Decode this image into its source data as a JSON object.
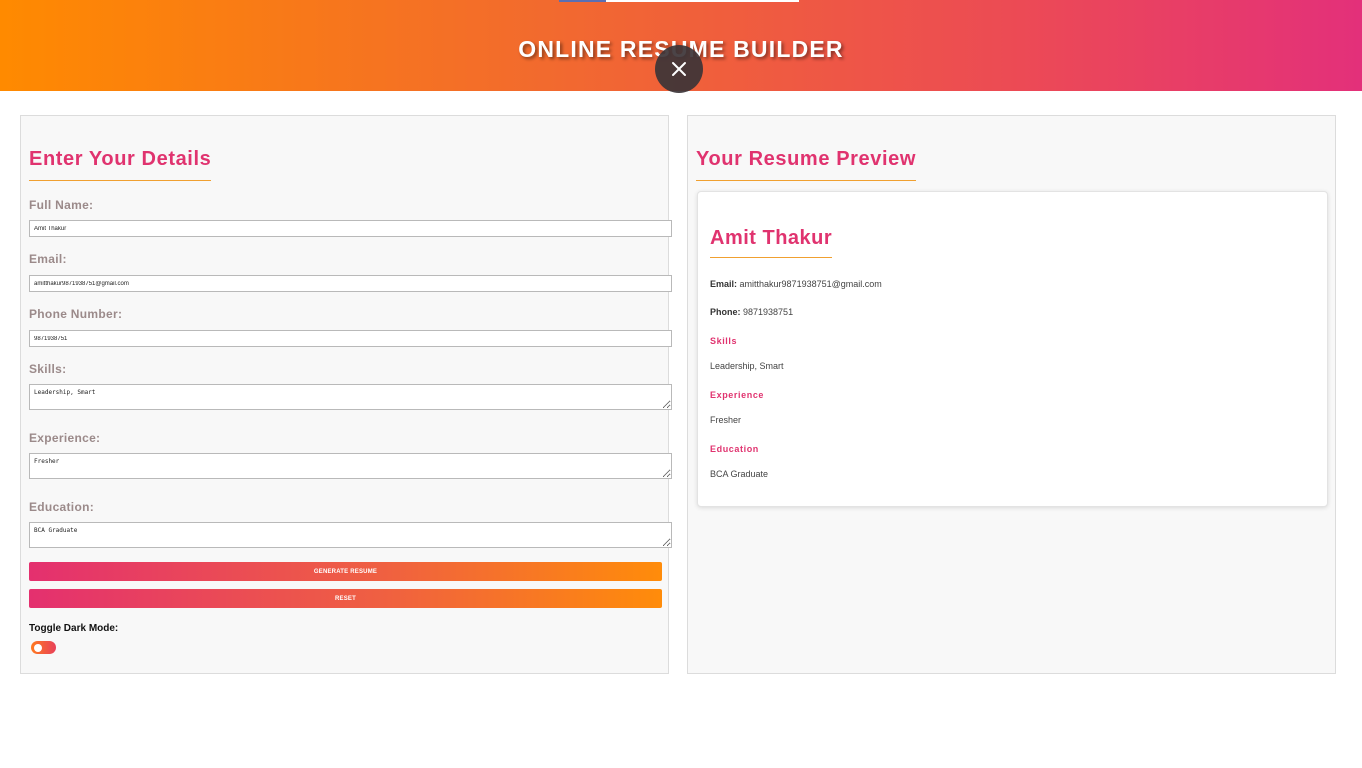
{
  "header": {
    "title": "ONLINE RESUME BUILDER"
  },
  "overlay": {
    "close_icon": "close-icon"
  },
  "form": {
    "title": "Enter Your Details",
    "full_name": {
      "label": "Full Name:",
      "value": "Amit Thakur"
    },
    "email": {
      "label": "Email:",
      "value": "amitthakur9871938751@gmail.com"
    },
    "phone": {
      "label": "Phone Number:",
      "value": "9871938751"
    },
    "skills": {
      "label": "Skills:",
      "value": "Leadership, Smart"
    },
    "experience": {
      "label": "Experience:",
      "value": "Fresher"
    },
    "education": {
      "label": "Education:",
      "value": "BCA Graduate"
    },
    "generate_label": "GENERATE RESUME",
    "reset_label": "RESET",
    "dark_mode_label": "Toggle Dark Mode:"
  },
  "preview": {
    "title": "Your Resume Preview",
    "name": "Amit Thakur",
    "email_label": "Email:",
    "email": "amitthakur9871938751@gmail.com",
    "phone_label": "Phone:",
    "phone": "9871938751",
    "skills_heading": "Skills",
    "skills": "Leadership, Smart",
    "experience_heading": "Experience",
    "experience": "Fresher",
    "education_heading": "Education",
    "education": "BCA Graduate"
  },
  "colors": {
    "accent_pink": "#e0336f",
    "accent_orange": "#ff8a00",
    "underline": "#f0a030"
  }
}
